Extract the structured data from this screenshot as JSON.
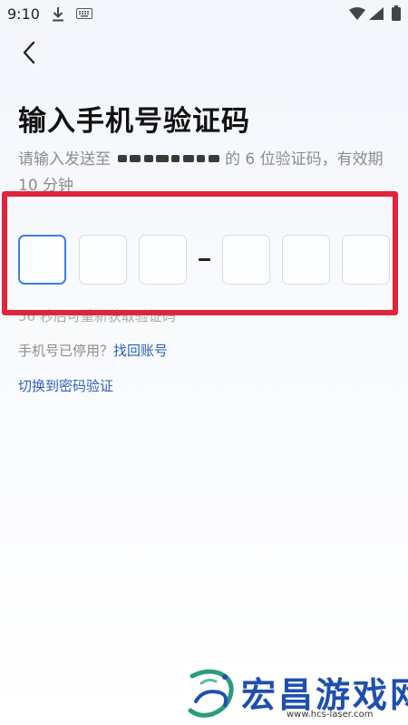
{
  "status_bar": {
    "time": "9:10",
    "icons": [
      "download-icon",
      "keyboard-icon",
      "wifi-icon",
      "signal-icon",
      "battery-icon"
    ]
  },
  "header": {
    "back_icon": "chevron-left-icon",
    "title": "输入手机号验证码"
  },
  "subtitle": {
    "before": "请输入发送至",
    "after": "的 6 位验证码，有效期 10 分钟"
  },
  "code_input": {
    "length": 6,
    "values": [
      "",
      "",
      "",
      "",
      "",
      ""
    ],
    "active_index": 0,
    "separator": "-"
  },
  "resend": {
    "text": "56 秒后可重新获取验证码"
  },
  "phone_disabled": {
    "label": "手机号已停用？",
    "link": "找回账号"
  },
  "switch_link": "切换到密码验证",
  "colors": {
    "accent": "#3f7ee8",
    "link": "#2d5fbf",
    "highlight": "#e0243e"
  },
  "watermark": {
    "title": "宏昌游戏网",
    "url": "www.hcs-laser.com"
  }
}
